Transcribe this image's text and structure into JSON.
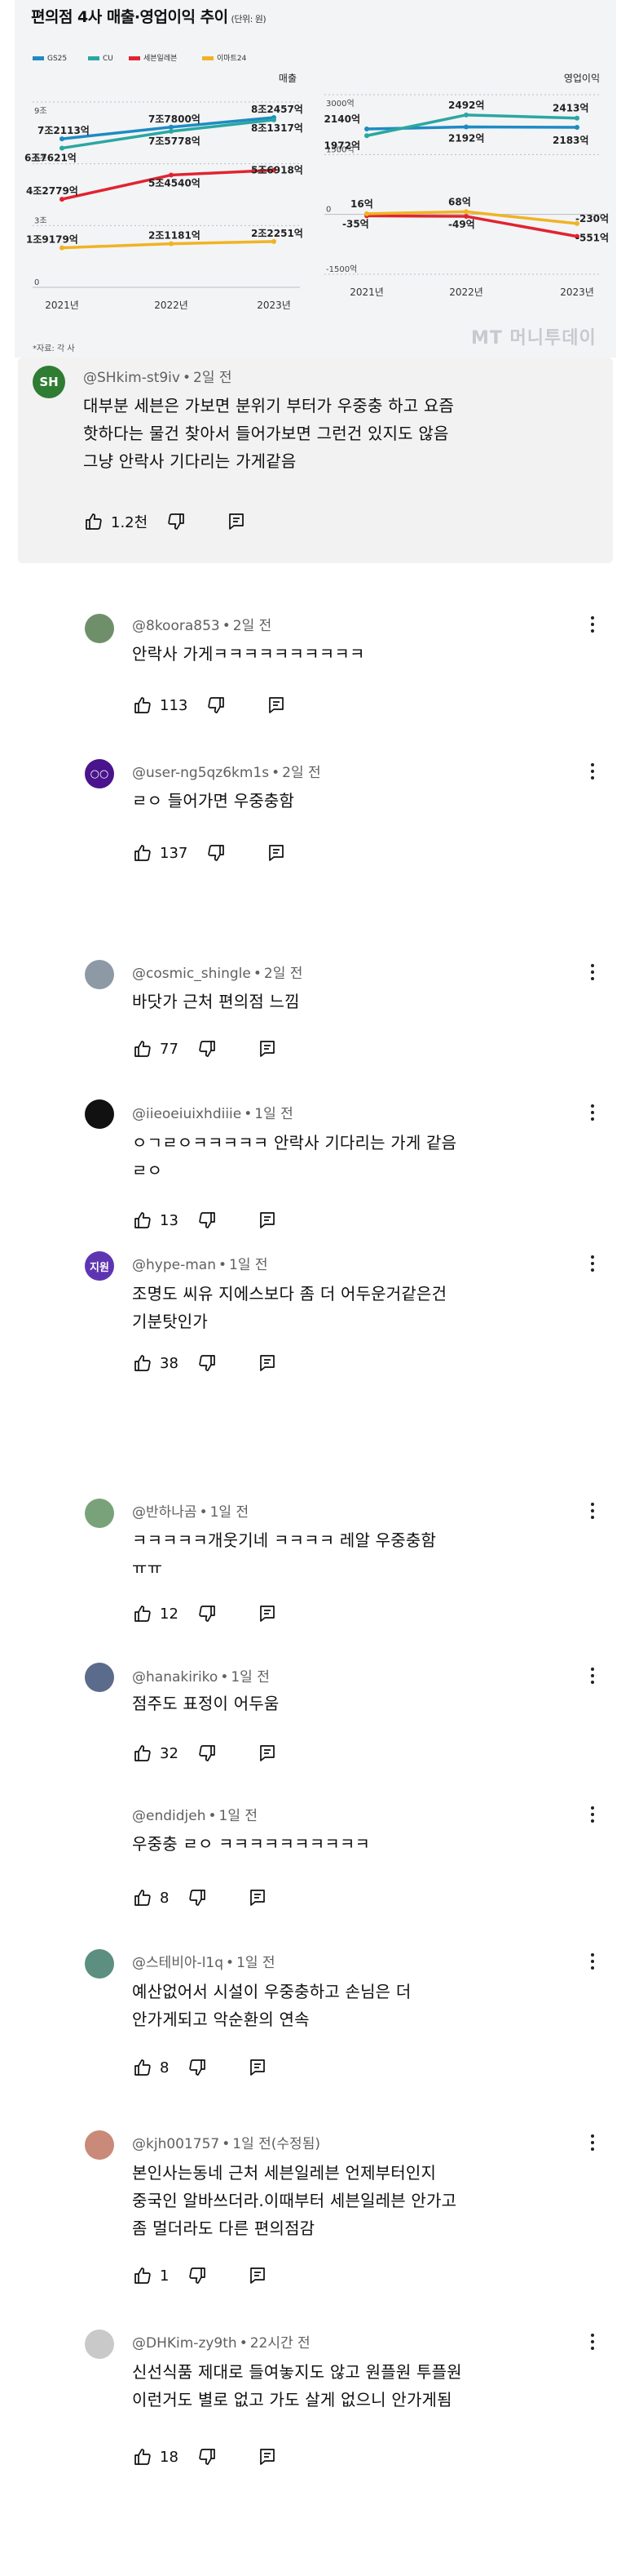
{
  "chart_card": {
    "title": "편의점 4사 매출·영업이익 추이",
    "unit": "(단위: 원)",
    "source": "*자료: 각 사",
    "watermark": "MT 머니투데이"
  },
  "chart_data": [
    {
      "type": "line",
      "title": "매출",
      "x": [
        "2021년",
        "2022년",
        "2023년"
      ],
      "yticks": [
        "9조",
        "6조",
        "3조",
        "0"
      ],
      "ylim": [
        0,
        9
      ],
      "legend": [
        "GS25",
        "CU",
        "세븐일레븐",
        "이마트24"
      ],
      "series": [
        {
          "name": "GS25",
          "color": "#1e8bc3",
          "values": [
            7.2113,
            7.78,
            8.2457
          ],
          "labels": [
            "7조2113억",
            "7조7800억",
            "8조2457억"
          ]
        },
        {
          "name": "CU",
          "color": "#2aa7a1",
          "values": [
            6.7621,
            7.5778,
            8.1317
          ],
          "labels": [
            "6조7621억",
            "7조5778억",
            "8조1317억"
          ]
        },
        {
          "name": "세븐일레븐",
          "color": "#e0242f",
          "values": [
            4.2779,
            5.454,
            5.6918
          ],
          "labels": [
            "4조2779억",
            "5조4540억",
            "5조6918억"
          ]
        },
        {
          "name": "이마트24",
          "color": "#f0b323",
          "values": [
            1.9179,
            2.1181,
            2.2251
          ],
          "labels": [
            "1조9179억",
            "2조1181억",
            "2조2251억"
          ]
        }
      ]
    },
    {
      "type": "line",
      "title": "영업이익",
      "x": [
        "2021년",
        "2022년",
        "2023년"
      ],
      "yticks": [
        "3000억",
        "1500억",
        "0",
        "-1500억"
      ],
      "ylim": [
        -1500,
        3000
      ],
      "series": [
        {
          "name": "GS25",
          "color": "#1e8bc3",
          "values": [
            2140,
            2192,
            2183
          ],
          "labels": [
            "2140억",
            "2192억",
            "2183억"
          ]
        },
        {
          "name": "CU",
          "color": "#2aa7a1",
          "values": [
            1972,
            2492,
            2413
          ],
          "labels": [
            "1972억",
            "2492억",
            "2413억"
          ]
        },
        {
          "name": "세븐일레븐",
          "color": "#e0242f",
          "values": [
            -35,
            -49,
            -551
          ],
          "labels": [
            "-35억",
            "-49억",
            "-551억"
          ]
        },
        {
          "name": "이마트24",
          "color": "#f0b323",
          "values": [
            16,
            68,
            -230
          ],
          "labels": [
            "16억",
            "68억",
            "-230억"
          ]
        }
      ]
    }
  ],
  "comments": [
    {
      "author": "@SHkim-st9iv",
      "time": "2일 전",
      "avatar": "SH",
      "avatar_color": "#2e7d32",
      "text": "대부분 세븐은 가보면 분위기 부터가 우중충 하고 요즘\n핫하다는 물건 찾아서 들어가보면 그런건 있지도 않음\n그냥 안락사 기다리는 가게같음",
      "likes": "1.2천"
    },
    {
      "author": "@8koora853",
      "time": "2일 전",
      "avatar": "",
      "avatar_color": "#6f8f6a",
      "text": "안락사 가게ㅋㅋㅋㅋㅋㅋㅋㅋㅋㅋ",
      "likes": "113"
    },
    {
      "author": "@user-ng5qz6km1s",
      "time": "2일 전",
      "avatar": "○○",
      "avatar_color": "#4a148c",
      "text": "ㄹㅇ 들어가면 우중충함",
      "likes": "137"
    },
    {
      "author": "@cosmic_shingle",
      "time": "2일 전",
      "avatar": "",
      "avatar_color": "#8d9aa5",
      "text": "바닷가 근처 편의점 느낌",
      "likes": "77"
    },
    {
      "author": "@iieoeiuixhdiiie",
      "time": "1일 전",
      "avatar": "",
      "avatar_color": "#111111",
      "text": "ㅇㄱㄹㅇㅋㅋㅋㅋㅋ 안락사 기다리는 가게 같음\nㄹㅇ",
      "likes": "13"
    },
    {
      "author": "@hype-man",
      "time": "1일 전",
      "avatar": "지원",
      "avatar_color": "#5e35b1",
      "text": "조명도 씨유 지에스보다 좀 더 어두운거같은건\n기분탓인가",
      "likes": "38"
    },
    {
      "author": "@반하나곰",
      "time": "1일 전",
      "avatar": "",
      "avatar_color": "#7aa27a",
      "text": "ㅋㅋㅋㅋㅋ개웃기네 ㅋㅋㅋㅋ 레알 우중충함\nㅠㅠ",
      "likes": "12"
    },
    {
      "author": "@hanakiriko",
      "time": "1일 전",
      "avatar": "",
      "avatar_color": "#5b6b8c",
      "text": "점주도 표정이 어두움",
      "likes": "32"
    },
    {
      "author": "@endidjeh",
      "time": "1일 전",
      "avatar": "",
      "avatar_color": "",
      "text": "우중충 ㄹㅇ ㅋㅋㅋㅋㅋㅋㅋㅋㅋㅋ",
      "likes": "8"
    },
    {
      "author": "@스테비아-l1q",
      "time": "1일 전",
      "avatar": "",
      "avatar_color": "#5c8f80",
      "text": "예산없어서 시설이 우중충하고 손님은 더\n안가게되고 악순환의 연속",
      "likes": "8"
    },
    {
      "author": "@kjh001757",
      "time": "1일 전(수정됨)",
      "avatar": "",
      "avatar_color": "#c98a7a",
      "text": "본인사는동네 근처 세븐일레븐 언제부터인지\n중국인 알바쓰더라.이때부터 세븐일레븐 안가고\n좀 멀더라도 다른 편의점감",
      "likes": "1"
    },
    {
      "author": "@DHKim-zy9th",
      "time": "22시간 전",
      "avatar": "",
      "avatar_color": "#c9c9c9",
      "text": "신선식품 제대로 들여놓지도 않고 원플원 투플원\n이런거도 별로 없고 가도 살게 없으니 안가게됨",
      "likes": "18"
    }
  ],
  "icons": {
    "like": "thumbs-up-icon",
    "dislike": "thumbs-down-icon",
    "reply": "reply-icon",
    "more": "kebab-menu-icon"
  }
}
